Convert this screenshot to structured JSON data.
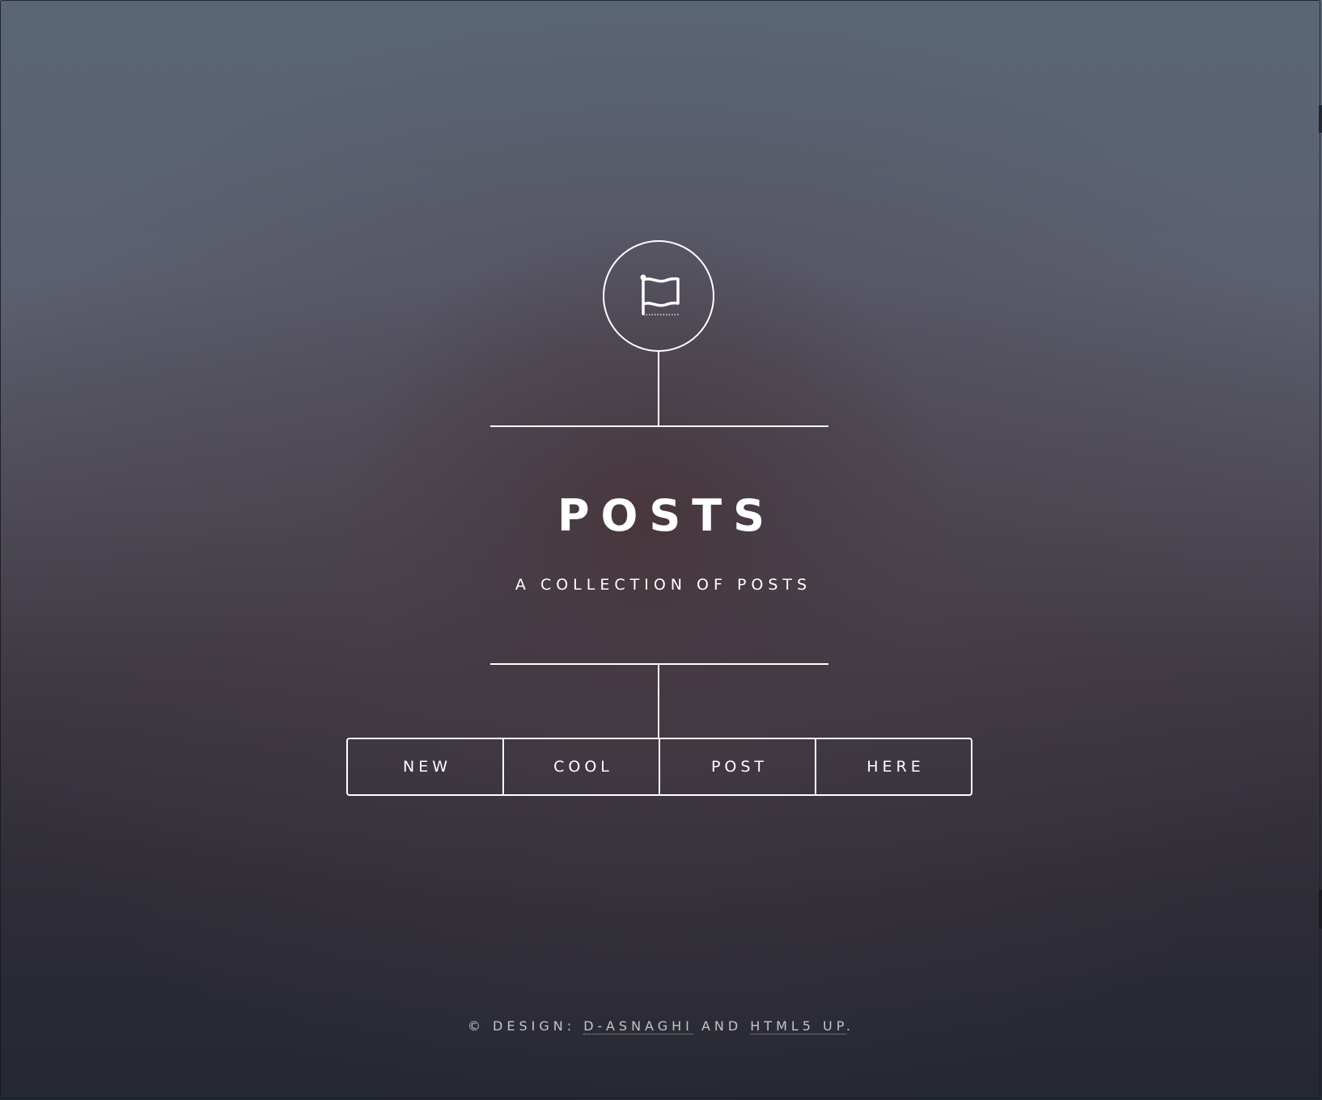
{
  "header": {
    "logo_icon": "flag-icon",
    "title": "POSTS",
    "subtitle": "A COLLECTION OF POSTS"
  },
  "nav": {
    "items": [
      {
        "label": "NEW"
      },
      {
        "label": "COOL"
      },
      {
        "label": "POST"
      },
      {
        "label": "HERE"
      }
    ]
  },
  "footer": {
    "copyright_prefix": "© DESIGN:",
    "link_1": "D-ASNAGHI",
    "joiner": "AND",
    "link_2": "HTML5 UP",
    "suffix": "."
  },
  "colors": {
    "foreground": "#ffffff",
    "background_top": "#5a6676",
    "background_bottom": "#242833"
  }
}
